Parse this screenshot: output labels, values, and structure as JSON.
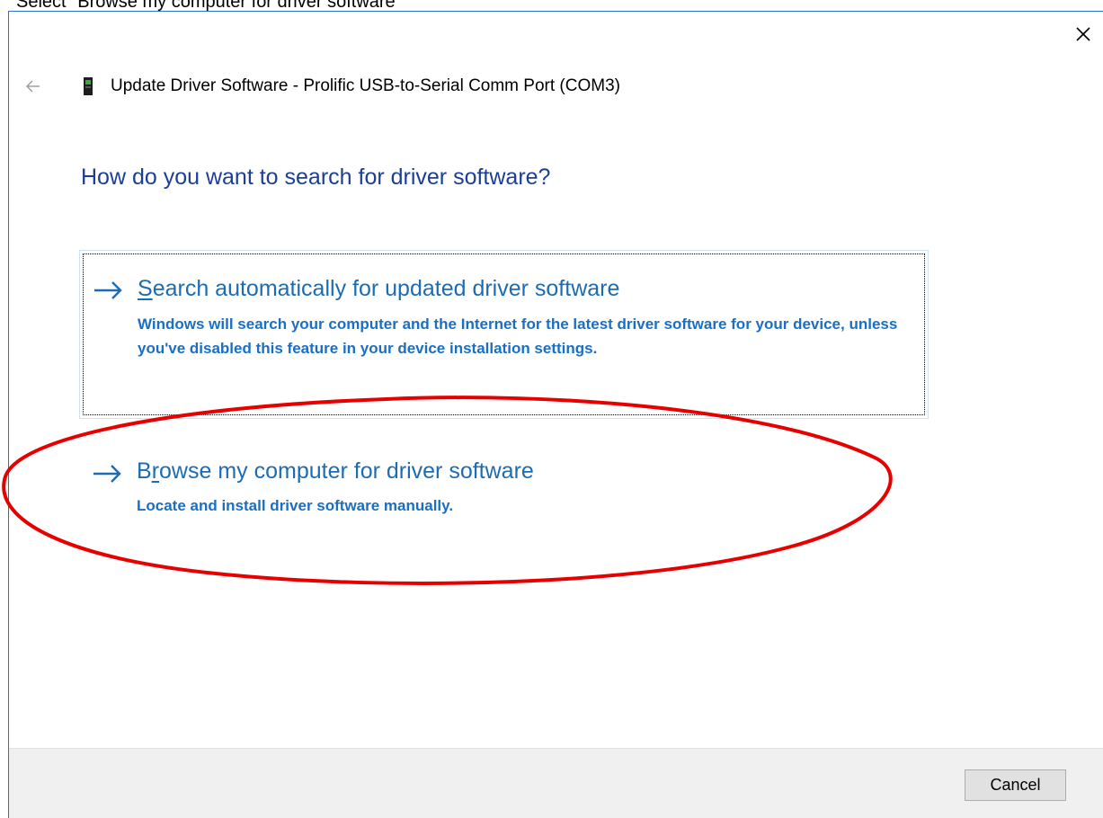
{
  "caption": {
    "text": "Select \"Browse my computer for driver software\""
  },
  "window": {
    "title": "Update Driver Software - Prolific USB-to-Serial Comm Port (COM3)",
    "back_icon": "back-arrow-icon",
    "close_icon": "close-icon",
    "device_icon": "usb-serial-device-icon"
  },
  "content": {
    "heading": "How do you want to search for driver software?",
    "options": [
      {
        "title_mnemonic": "S",
        "title_rest": "earch automatically for updated driver software",
        "description": "Windows will search your computer and the Internet for the latest driver software for your device, unless you've disabled this feature in your device installation settings.",
        "icon": "right-arrow-icon",
        "focused": true
      },
      {
        "title_prefix": "B",
        "title_mnemonic": "r",
        "title_rest": "owse my computer for driver software",
        "description": "Locate and install driver software manually.",
        "icon": "right-arrow-icon",
        "highlighted": true
      }
    ]
  },
  "footer": {
    "cancel_label": "Cancel"
  },
  "colors": {
    "heading": "#1c3f95",
    "link": "#1c6cb4",
    "annotation": "#e60000",
    "window_border": "#2b72c7"
  }
}
